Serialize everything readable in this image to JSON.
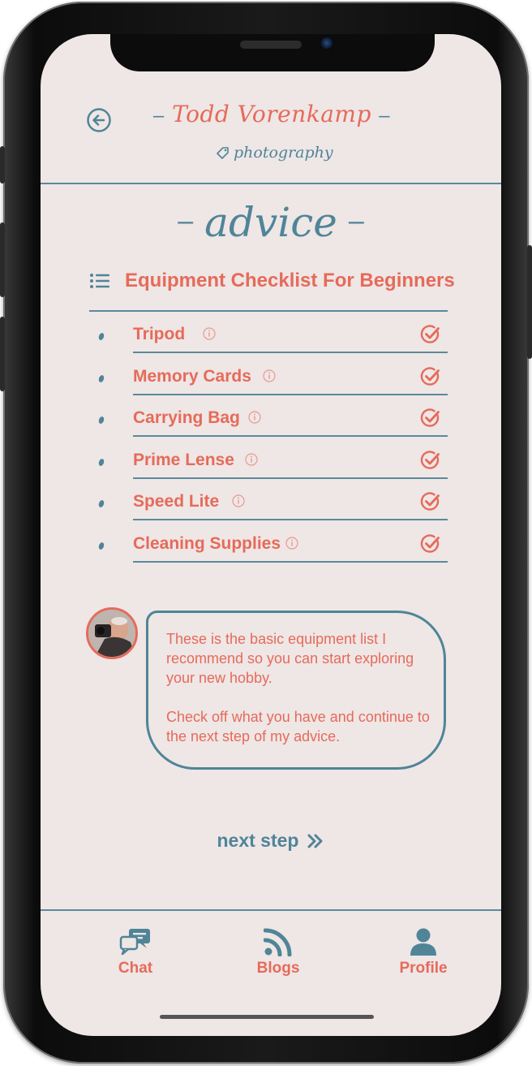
{
  "header": {
    "brand_name": "Todd Vorenkamp",
    "brand_sub": "photography",
    "back_icon": "back-arrow-circle-icon"
  },
  "page": {
    "title": "advice"
  },
  "checklist": {
    "title": "Equipment Checklist For Beginners",
    "items": [
      {
        "label": "Tripod",
        "checked": true
      },
      {
        "label": "Memory Cards",
        "checked": true
      },
      {
        "label": "Carrying Bag",
        "checked": true
      },
      {
        "label": "Prime Lense",
        "checked": true
      },
      {
        "label": "Speed Lite",
        "checked": true
      },
      {
        "label": "Cleaning Supplies",
        "checked": true
      }
    ]
  },
  "message": {
    "paragraph1": "These is the basic equipment list I recommend so you can start exploring your new hobby.",
    "paragraph2": "Check off what you have and continue to the next step of my advice."
  },
  "next_step": {
    "label": "next step"
  },
  "nav": {
    "items": [
      {
        "label": "Chat",
        "icon": "chat-icon"
      },
      {
        "label": "Blogs",
        "icon": "rss-icon"
      },
      {
        "label": "Profile",
        "icon": "user-icon"
      }
    ]
  },
  "colors": {
    "accent": "#e56b59",
    "teal": "#4f8597",
    "background": "#efe6e6"
  }
}
